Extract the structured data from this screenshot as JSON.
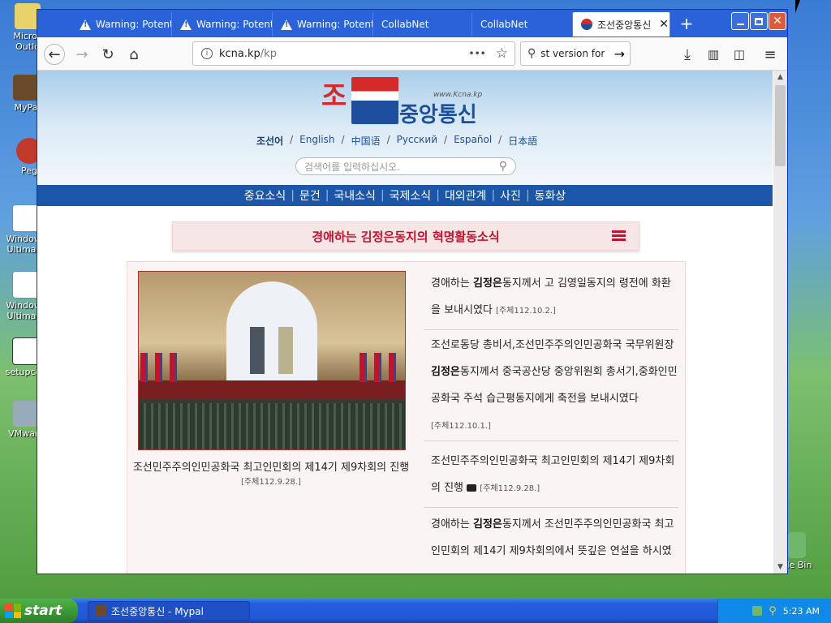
{
  "desktop": {
    "icons": [
      "Micros Outlo",
      "MyPa",
      "Peg",
      "Windows Ultimate",
      "Windows Ultimate",
      "setupcen",
      "VMware",
      "cle Bin"
    ]
  },
  "browser": {
    "tabs": [
      {
        "label": "Warning: Potent",
        "icon": "warning-icon"
      },
      {
        "label": "Warning: Potent",
        "icon": "warning-icon"
      },
      {
        "label": "Warning: Potent",
        "icon": "warning-icon"
      },
      {
        "label": "CollabNet",
        "icon": ""
      },
      {
        "label": "CollabNet",
        "icon": ""
      },
      {
        "label": "조선중앙통신",
        "icon": "kcna-icon"
      }
    ],
    "new_tab": "+",
    "url": "kcna.kp/kp",
    "url_host": "kcna.kp",
    "url_path": "/kp",
    "search_text": "st version for",
    "url_more": "•••"
  },
  "site": {
    "logo_top": "조  선",
    "logo_bottom": "중앙통신",
    "logo_url": "www.Kcna.kp",
    "languages": [
      "조선어",
      "English",
      "中国语",
      "Русский",
      "Español",
      "日本語"
    ],
    "search_placeholder": "검색어를 입력하십시오.",
    "menu": [
      "중요소식",
      "문건",
      "국내소식",
      "국제소식",
      "대외관계",
      "사진",
      "동화상"
    ],
    "section_title": "경애하는 김정은동지의 혁명활동소식",
    "photo_caption": "조선민주주의인민공화국 최고인민회의 제14기 제9차회의 진행",
    "photo_date": "[주체112.9.28.]",
    "news": [
      {
        "pre": "경애하는 ",
        "bold": "김정은",
        "post": "동지께서 고 김영일동지의 령전에 화환을 보내시였다",
        "date": "[주체112.10.2.]"
      },
      {
        "pre": "조선로동당 총비서,조선민주주의인민공화국 국무위원장 ",
        "bold": "김정은",
        "post": "동지께서 중국공산당 중앙위원회 총서기,중화인민공화국 주석 습근평동지에게 축전을 보내시였다",
        "date": "[주체112.10.1.]"
      },
      {
        "pre": "조선민주주의인민공화국 최고인민회의 제14기 제9차회의 진행",
        "bold": "",
        "post": "",
        "date": "[주체112.9.28.]",
        "camera": true
      },
      {
        "pre": "경애하는 ",
        "bold": "김정은",
        "post": "동지께서 조선민주주의인민공화국 최고인민회의 제14기 제9차회의에서 뜻깊은 연설을 하시였",
        "date": ""
      }
    ]
  },
  "taskbar": {
    "start": "start",
    "task": "조선중앙통신 - Mypal",
    "time": "5:23 AM"
  }
}
